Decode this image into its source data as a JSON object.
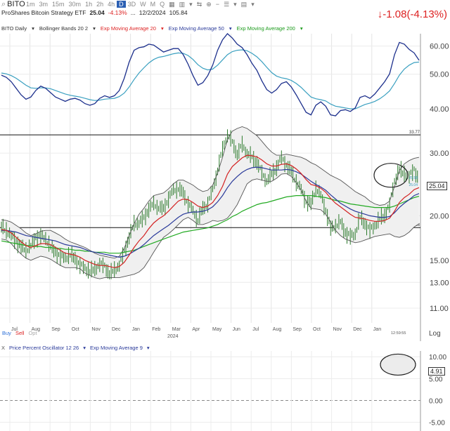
{
  "toolbar": {
    "symbol": "BITO",
    "timeframes": [
      {
        "label": "1m",
        "active": false
      },
      {
        "label": "3m",
        "active": false
      },
      {
        "label": "15m",
        "active": false
      },
      {
        "label": "30m",
        "active": false
      },
      {
        "label": "1h",
        "active": false
      },
      {
        "label": "2h",
        "active": false
      },
      {
        "label": "4h",
        "active": false
      },
      {
        "label": "D",
        "active": true
      },
      {
        "label": "3D",
        "active": false
      },
      {
        "label": "W",
        "active": false
      },
      {
        "label": "M",
        "active": false
      },
      {
        "label": "Q",
        "active": false
      }
    ]
  },
  "quote": {
    "name": "ProShares Bitcoin Strategy ETF",
    "last": "25.04",
    "change_pct": "-4.13%",
    "ellipsis": "...",
    "date": "12/2/2024",
    "volume": "105.84",
    "big_change": "↓-1.08(-4.13%)"
  },
  "studies": {
    "symbol_period": "BITO Daily",
    "bollinger": "Bollinger Bands 20 2",
    "ema20": "Exp Moving Average 20",
    "ema50": "Exp Moving Average 50",
    "ema200": "Exp Moving Average 200"
  },
  "price_value_tag": "25.04",
  "time_label": "12:59:55",
  "trade": {
    "buy": "Buy",
    "sell": "Sell",
    "opt": "Opt"
  },
  "log_label": "Log",
  "oscillator": {
    "close_x": "X",
    "title": "Price Percent Oscillator 12 26",
    "signal": "Exp Moving Average 9",
    "value_tag": "4.91",
    "y_ticks": [
      "10.00",
      "5.00",
      "0.00",
      "-5.00"
    ]
  },
  "colors": {
    "ema20": "#d32222",
    "ema50": "#2a3a9a",
    "ema200": "#22aa22",
    "bars": "#2b7a2b",
    "bands": "#555555",
    "ppo": "#1c2f8c",
    "ppo_signal": "#3aa0c0",
    "change_down": "#d22222"
  },
  "chart_data": [
    {
      "type": "line",
      "title": "BITO Daily",
      "y_scale": "log",
      "ylim": [
        10,
        65
      ],
      "y_ticks": [
        60,
        50,
        40,
        30,
        20,
        15,
        13,
        11
      ],
      "y_tick_labels": [
        "60.00",
        "50.00",
        "40.00",
        "30.00",
        "20.00",
        "15.00",
        "13.00",
        "11.00"
      ],
      "x_tick_labels": [
        "Jul",
        "Aug",
        "Sep",
        "Oct",
        "Nov",
        "Dec",
        "Jan",
        "Feb",
        "Mar",
        "Apr",
        "May",
        "Jun",
        "Jul",
        "Aug",
        "Sep",
        "Oct",
        "Nov",
        "Dec",
        "Jan"
      ],
      "x_sub_label": "2024",
      "horizontal_lines": [
        {
          "value": 33.77,
          "label": "33.77"
        },
        {
          "value": 18.53,
          "label": "18.53"
        }
      ],
      "last_price": 25.04,
      "band_labels": [
        "25.58",
        "25.04"
      ],
      "grid": true,
      "series": [
        {
          "name": "BITO",
          "style": "ohlc",
          "values": [
            18.6,
            18.2,
            17.6,
            17.0,
            16.4,
            16.0,
            16.5,
            17.4,
            17.6,
            17.2,
            16.4,
            15.8,
            15.4,
            15.2,
            15.6,
            15.1,
            14.6,
            14.2,
            14.0,
            14.1,
            14.7,
            14.4,
            13.8,
            14.0,
            14.6,
            15.8,
            17.5,
            18.9,
            19.2,
            19.6,
            21.0,
            21.5,
            21.2,
            20.8,
            22.5,
            23.5,
            24.0,
            23.0,
            21.8,
            20.5,
            19.6,
            20.8,
            21.8,
            23.5,
            27.0,
            30.5,
            34.0,
            32.0,
            30.0,
            31.5,
            30.2,
            29.0,
            28.5,
            26.2,
            25.2,
            26.0,
            27.5,
            29.0,
            28.0,
            26.5,
            25.0,
            23.6,
            22.0,
            21.5,
            24.0,
            22.8,
            20.8,
            18.4,
            18.8,
            19.2,
            18.0,
            17.5,
            17.8,
            19.8,
            19.0,
            18.2,
            18.8,
            19.6,
            20.0,
            21.5,
            25.0,
            27.0,
            26.2,
            25.8,
            27.0,
            25.04
          ]
        },
        {
          "name": "Exp Moving Average 20",
          "values": [
            18.3,
            18.2,
            17.9,
            17.4,
            16.9,
            16.5,
            16.3,
            16.5,
            16.7,
            16.7,
            16.6,
            16.3,
            16.0,
            15.7,
            15.6,
            15.5,
            15.3,
            15.0,
            14.8,
            14.6,
            14.5,
            14.5,
            14.4,
            14.3,
            14.4,
            14.8,
            15.5,
            16.3,
            17.0,
            17.6,
            18.4,
            19.1,
            19.6,
            20.0,
            20.6,
            21.3,
            22.0,
            22.3,
            22.2,
            21.8,
            21.3,
            21.1,
            21.3,
            21.8,
            22.8,
            24.2,
            26.2,
            27.5,
            28.3,
            29.1,
            29.6,
            29.5,
            29.3,
            28.7,
            28.0,
            27.6,
            27.6,
            27.9,
            28.0,
            27.7,
            27.1,
            26.3,
            25.3,
            24.5,
            24.3,
            23.9,
            23.3,
            22.4,
            21.7,
            21.2,
            20.7,
            20.2,
            19.8,
            19.7,
            19.6,
            19.4,
            19.3,
            19.3,
            19.4,
            19.7,
            20.6,
            21.8,
            22.5,
            23.0,
            23.7,
            24.0
          ]
        },
        {
          "name": "Exp Moving Average 50",
          "values": [
            18.2,
            18.2,
            18.1,
            18.0,
            17.8,
            17.6,
            17.5,
            17.4,
            17.3,
            17.2,
            17.1,
            17.0,
            16.8,
            16.6,
            16.5,
            16.4,
            16.3,
            16.1,
            15.9,
            15.8,
            15.7,
            15.6,
            15.5,
            15.4,
            15.3,
            15.4,
            15.6,
            15.9,
            16.2,
            16.6,
            17.1,
            17.6,
            18.0,
            18.4,
            18.8,
            19.3,
            19.8,
            20.2,
            20.4,
            20.5,
            20.5,
            20.6,
            20.8,
            21.2,
            21.9,
            22.8,
            24.0,
            25.0,
            25.8,
            26.5,
            27.0,
            27.3,
            27.4,
            27.3,
            27.1,
            26.9,
            26.9,
            26.9,
            27.0,
            26.9,
            26.6,
            26.2,
            25.6,
            25.0,
            24.5,
            24.1,
            23.6,
            22.9,
            22.3,
            21.7,
            21.3,
            20.9,
            20.6,
            20.4,
            20.2,
            20.0,
            19.9,
            19.8,
            19.8,
            19.9,
            20.4,
            21.1,
            21.7,
            22.2,
            22.8,
            23.1
          ]
        },
        {
          "name": "Exp Moving Average 200",
          "values": [
            17.0,
            16.9,
            16.8,
            16.7,
            16.6,
            16.5,
            16.5,
            16.4,
            16.4,
            16.3,
            16.3,
            16.2,
            16.2,
            16.1,
            16.1,
            16.0,
            16.0,
            15.9,
            15.9,
            15.8,
            15.8,
            15.8,
            15.7,
            15.7,
            15.7,
            15.8,
            15.9,
            16.0,
            16.2,
            16.4,
            16.6,
            16.8,
            17.0,
            17.2,
            17.4,
            17.6,
            17.8,
            18.0,
            18.1,
            18.2,
            18.3,
            18.4,
            18.5,
            18.7,
            18.9,
            19.2,
            19.5,
            19.9,
            20.2,
            20.6,
            20.9,
            21.2,
            21.5,
            21.7,
            21.8,
            22.0,
            22.2,
            22.4,
            22.6,
            22.7,
            22.8,
            22.8,
            22.8,
            22.8,
            22.7,
            22.6,
            22.5,
            22.3,
            22.1,
            22.0,
            21.8,
            21.6,
            21.5,
            21.4,
            21.3,
            21.2,
            21.1,
            21.1,
            21.1,
            21.1,
            21.3,
            21.6,
            21.9,
            22.2,
            22.5,
            22.7
          ]
        },
        {
          "name": "Bollinger Upper",
          "values": [
            19.5,
            19.4,
            19.2,
            18.8,
            18.4,
            17.9,
            17.6,
            17.8,
            18.1,
            18.2,
            18.2,
            17.9,
            17.6,
            17.2,
            16.9,
            16.7,
            16.5,
            16.3,
            16.0,
            15.7,
            15.5,
            15.4,
            15.3,
            15.2,
            15.4,
            16.2,
            17.6,
            19.0,
            20.2,
            21.0,
            22.0,
            22.8,
            23.0,
            23.2,
            23.8,
            24.6,
            25.2,
            25.2,
            24.8,
            24.4,
            23.8,
            23.4,
            23.6,
            24.4,
            26.4,
            29.2,
            32.8,
            34.6,
            35.2,
            35.6,
            35.2,
            34.4,
            33.6,
            32.4,
            31.2,
            30.2,
            29.6,
            29.6,
            29.8,
            29.6,
            29.4,
            29.2,
            28.8,
            28.2,
            27.8,
            27.2,
            26.6,
            26.0,
            25.6,
            25.2,
            24.6,
            24.0,
            23.4,
            23.0,
            22.6,
            22.0,
            21.6,
            21.4,
            21.5,
            22.0,
            24.2,
            26.8,
            28.0,
            28.6,
            29.0,
            29.2
          ]
        },
        {
          "name": "Bollinger Lower",
          "values": [
            17.2,
            17.1,
            16.7,
            16.1,
            15.6,
            15.2,
            15.0,
            15.2,
            15.4,
            15.3,
            15.1,
            14.8,
            14.5,
            14.3,
            14.3,
            14.3,
            14.2,
            13.8,
            13.6,
            13.4,
            13.3,
            13.4,
            13.4,
            13.4,
            13.4,
            13.5,
            13.6,
            13.7,
            13.9,
            14.3,
            15.0,
            15.8,
            16.6,
            17.4,
            17.8,
            18.3,
            18.9,
            19.5,
            19.8,
            19.4,
            18.9,
            18.9,
            19.1,
            19.4,
            19.3,
            19.4,
            19.7,
            20.5,
            21.5,
            23.0,
            24.6,
            25.2,
            25.4,
            25.2,
            25.0,
            25.0,
            25.5,
            26.2,
            26.3,
            25.8,
            24.8,
            23.6,
            22.0,
            21.0,
            20.9,
            20.8,
            20.2,
            19.2,
            18.2,
            17.6,
            17.2,
            17.0,
            16.8,
            16.9,
            17.1,
            17.3,
            17.5,
            17.6,
            17.7,
            17.8,
            17.5,
            17.4,
            17.6,
            18.0,
            18.6,
            19.0
          ]
        }
      ]
    },
    {
      "type": "line",
      "title": "Price Percent Oscillator 12 26",
      "ylim": [
        -7,
        11
      ],
      "y_ticks": [
        10,
        5,
        0,
        -5
      ],
      "y_tick_labels": [
        "10.00",
        "5.00",
        "0.00",
        "-5.00"
      ],
      "zero_line": true,
      "last_value": 4.91,
      "grid": true,
      "series": [
        {
          "name": "Price Percent Oscillator 12 26",
          "values": [
            1.5,
            1.0,
            0.0,
            -1.5,
            -3.0,
            -4.0,
            -3.5,
            -2.0,
            -1.0,
            -1.5,
            -2.5,
            -3.5,
            -4.0,
            -4.5,
            -4.0,
            -3.8,
            -4.2,
            -5.0,
            -5.4,
            -5.0,
            -3.8,
            -3.2,
            -3.6,
            -3.2,
            -2.0,
            0.8,
            4.5,
            7.2,
            7.8,
            8.0,
            8.6,
            8.4,
            7.6,
            6.8,
            7.2,
            7.6,
            7.6,
            6.2,
            4.0,
            1.4,
            -0.8,
            -0.2,
            1.4,
            3.8,
            7.2,
            9.6,
            11.0,
            10.0,
            8.6,
            7.8,
            6.2,
            4.2,
            2.6,
            0.2,
            -1.8,
            -2.6,
            -1.8,
            -0.4,
            0.0,
            -1.2,
            -3.0,
            -5.0,
            -7.0,
            -7.6,
            -5.4,
            -4.6,
            -5.6,
            -7.6,
            -7.8,
            -6.6,
            -6.4,
            -6.8,
            -6.0,
            -3.6,
            -3.2,
            -3.8,
            -2.8,
            -1.4,
            0.0,
            1.8,
            6.2,
            9.0,
            8.6,
            7.4,
            6.6,
            4.91
          ]
        },
        {
          "name": "Exp Moving Average 9",
          "values": [
            2.0,
            1.8,
            1.4,
            0.8,
            0.0,
            -0.8,
            -1.4,
            -1.5,
            -1.4,
            -1.4,
            -1.6,
            -2.0,
            -2.4,
            -2.8,
            -3.1,
            -3.3,
            -3.5,
            -3.8,
            -4.1,
            -4.3,
            -4.2,
            -4.0,
            -3.9,
            -3.8,
            -3.4,
            -2.6,
            -1.2,
            0.5,
            2.0,
            3.2,
            4.3,
            5.1,
            5.6,
            5.8,
            6.1,
            6.4,
            6.6,
            6.5,
            6.0,
            5.1,
            3.9,
            3.1,
            2.7,
            2.9,
            3.8,
            5.0,
            6.2,
            6.9,
            7.2,
            7.3,
            7.1,
            6.5,
            5.7,
            4.6,
            3.3,
            2.1,
            1.3,
            0.9,
            0.7,
            0.3,
            -0.4,
            -1.3,
            -2.4,
            -3.5,
            -3.9,
            -4.1,
            -4.4,
            -5.1,
            -5.6,
            -5.8,
            -6.0,
            -6.2,
            -6.2,
            -5.7,
            -5.2,
            -4.9,
            -4.5,
            -3.9,
            -3.1,
            -2.1,
            -0.4,
            1.5,
            2.9,
            3.8,
            4.4,
            4.5
          ]
        }
      ]
    }
  ]
}
